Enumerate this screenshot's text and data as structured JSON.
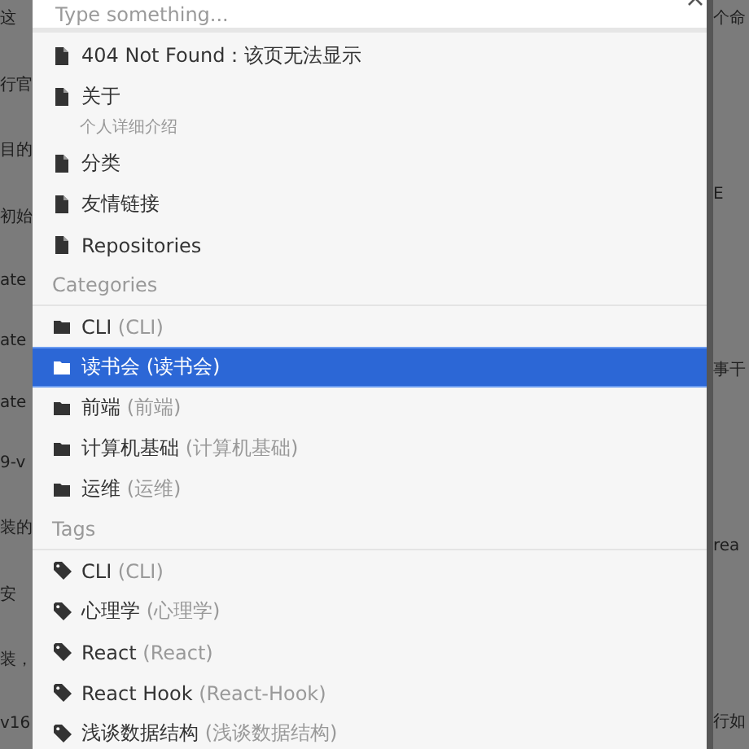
{
  "page_behind": {
    "left": [
      "这",
      "行官",
      "目的",
      "初始",
      "ate",
      "ate",
      "ate",
      "9-v",
      "装的",
      "安",
      "装，",
      "v16"
    ],
    "right": [
      "个命",
      "E",
      "事干",
      "rea",
      "行如"
    ]
  },
  "search": {
    "placeholder": "Type something..."
  },
  "results": [
    {
      "kind": "page",
      "title": "404 Not Found：该页无法显示",
      "selected": false
    },
    {
      "kind": "page",
      "title": "关于",
      "subtitle": "个人详细介绍",
      "selected": false
    },
    {
      "kind": "page",
      "title": "分类",
      "selected": false
    },
    {
      "kind": "page",
      "title": "友情链接",
      "selected": false
    },
    {
      "kind": "page",
      "title": "Repositories",
      "selected": false
    },
    {
      "kind": "heading",
      "title": "Categories"
    },
    {
      "kind": "category",
      "title": "CLI",
      "detail": "(CLI)",
      "selected": false
    },
    {
      "kind": "category",
      "title": "读书会",
      "detail": "(读书会)",
      "selected": true
    },
    {
      "kind": "category",
      "title": "前端",
      "detail": "(前端)",
      "selected": false
    },
    {
      "kind": "category",
      "title": "计算机基础",
      "detail": "(计算机基础)",
      "selected": false
    },
    {
      "kind": "category",
      "title": "运维",
      "detail": "(运维)",
      "selected": false
    },
    {
      "kind": "heading",
      "title": "Tags"
    },
    {
      "kind": "tag",
      "title": "CLI",
      "detail": "(CLI)",
      "selected": false
    },
    {
      "kind": "tag",
      "title": "心理学",
      "detail": "(心理学)",
      "selected": false
    },
    {
      "kind": "tag",
      "title": "React",
      "detail": "(React)",
      "selected": false
    },
    {
      "kind": "tag",
      "title": "React Hook",
      "detail": "(React-Hook)",
      "selected": false
    },
    {
      "kind": "tag",
      "title": "浅谈数据结构",
      "detail": "(浅谈数据结构)",
      "selected": false
    }
  ]
}
